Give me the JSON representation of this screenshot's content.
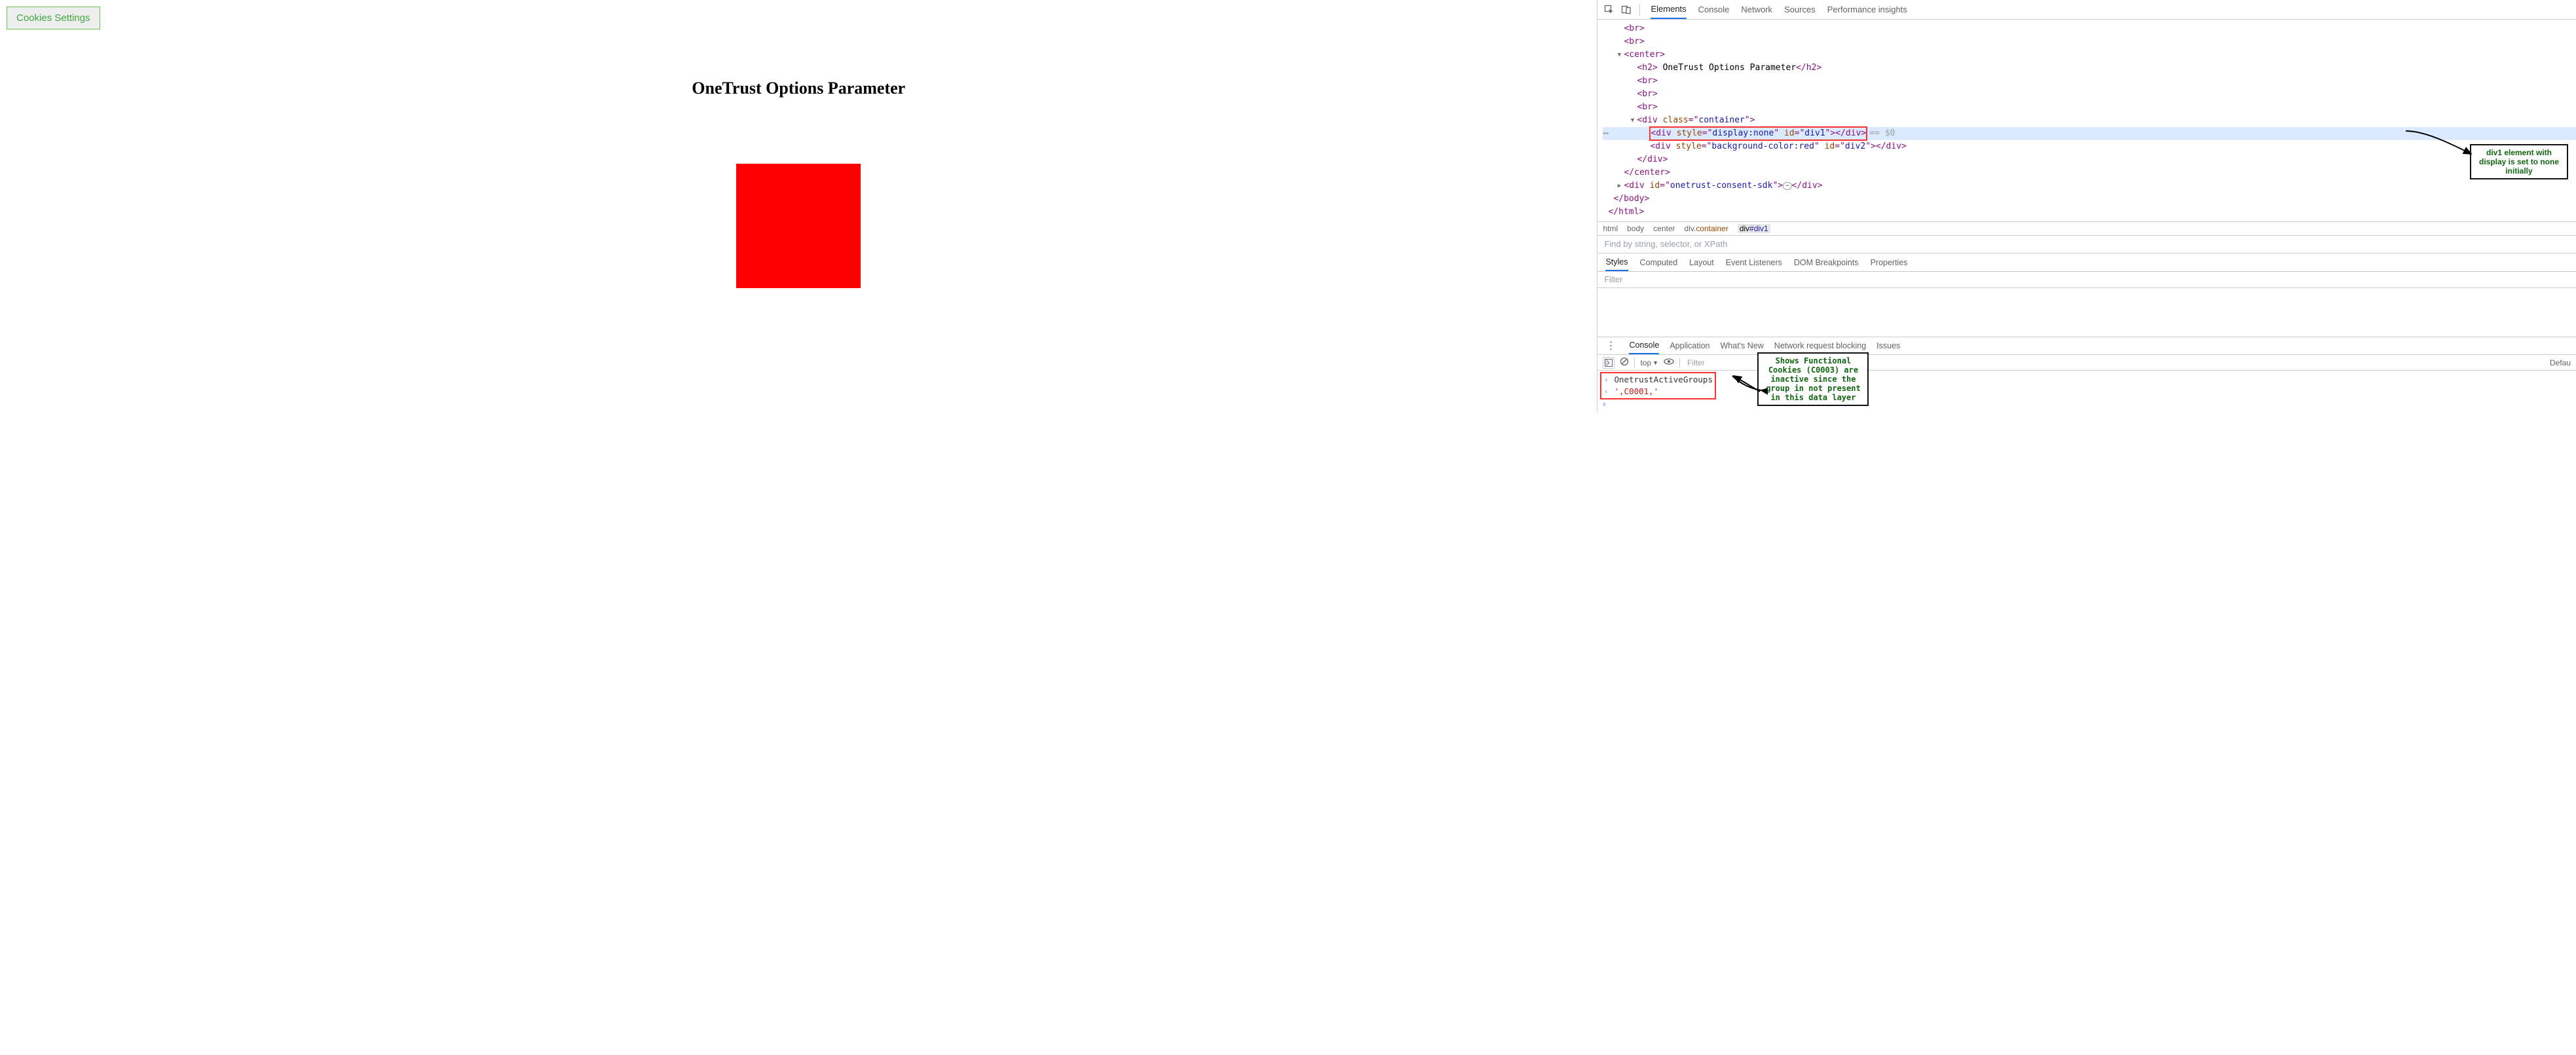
{
  "page": {
    "cookies_button": "Cookies Settings",
    "heading": "OneTrust Options Parameter"
  },
  "devtools": {
    "main_tabs": [
      "Elements",
      "Console",
      "Network",
      "Sources",
      "Performance insights"
    ],
    "active_main_tab": "Elements",
    "dom": {
      "l_br1": "<br>",
      "l_br2": "<br>",
      "l_center_o": "<center>",
      "l_h2_o": "<h2>",
      "l_h2_t": " OneTrust Options Parameter",
      "l_h2_c": "</h2>",
      "l_br3": "<br>",
      "l_br4": "<br>",
      "l_br5": "<br>",
      "l_div_co": "<div class=\"container\">",
      "l_div1": "<div style=\"display:none\" id=\"div1\"></div>",
      "l_div1_after": "== $0",
      "l_div2": "<div style=\"background-color:red\" id=\"div2\"></div>",
      "l_div_cc": "</div>",
      "l_center_c": "</center>",
      "l_sdk": "<div id=\"onetrust-consent-sdk\">⋯</div>",
      "l_body_c": "</body>",
      "l_html_c": "</html>"
    },
    "breadcrumbs": {
      "p0": "html",
      "p1": "body",
      "p2": "center",
      "p3_prefix": "div.",
      "p3_cls": "container",
      "p4_prefix": "div",
      "p4_id": "#div1"
    },
    "find_placeholder": "Find by string, selector, or XPath",
    "styles_tabs": [
      "Styles",
      "Computed",
      "Layout",
      "Event Listeners",
      "DOM Breakpoints",
      "Properties"
    ],
    "styles_filter_placeholder": "Filter",
    "drawer_tabs": [
      "Console",
      "Application",
      "What's New",
      "Network request blocking",
      "Issues"
    ],
    "console": {
      "context": "top",
      "filter_placeholder": "Filter",
      "default": "Defau",
      "input_line": "OnetrustActiveGroups",
      "output_line": "',C0001,'"
    }
  },
  "annotations": {
    "callout1": "div1 element with display is set to none initially",
    "callout2": "Shows Functional Cookies (C0003) are inactive since the group in not present in this data layer"
  }
}
